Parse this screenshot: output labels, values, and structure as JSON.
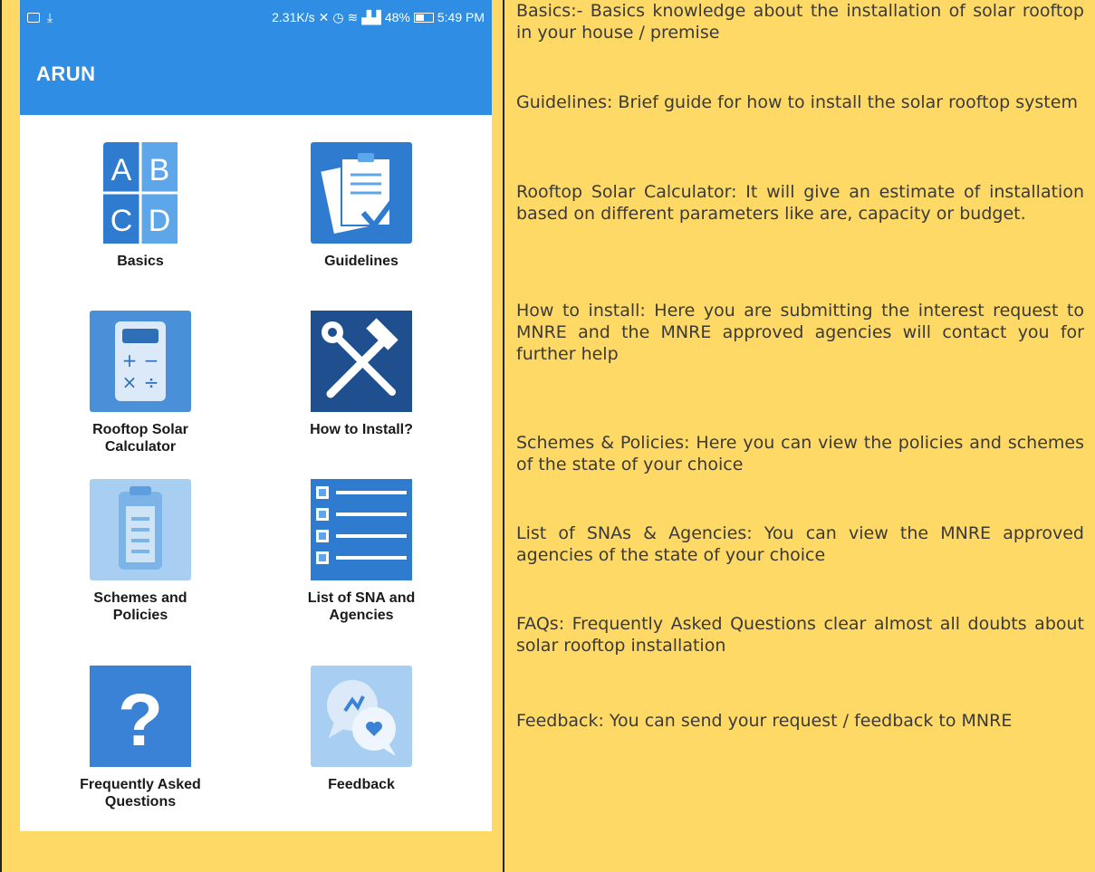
{
  "status_bar": {
    "speed": "2.31K/s",
    "battery": "48%",
    "time": "5:49 PM"
  },
  "app": {
    "title": "ARUN",
    "accent": "#2f8de4"
  },
  "tiles": [
    {
      "label": "Basics",
      "icon": "abcd-icon"
    },
    {
      "label": "Guidelines",
      "icon": "clipboard-check-icon"
    },
    {
      "label": "Rooftop Solar\nCalculator",
      "icon": "calculator-icon"
    },
    {
      "label": "How to Install?",
      "icon": "tools-icon"
    },
    {
      "label": "Schemes and\nPolicies",
      "icon": "document-icon"
    },
    {
      "label": "List of SNA and\nAgencies",
      "icon": "list-icon"
    },
    {
      "label": "Frequently Asked\nQuestions",
      "icon": "question-icon"
    },
    {
      "label": "Feedback",
      "icon": "chat-bubbles-icon"
    }
  ],
  "descriptions": [
    "Basics:- Basics knowledge about the installation of solar rooftop in your house / premise",
    "Guidelines: Brief guide for how to install the solar rooftop system",
    "Rooftop Solar Calculator: It will give an estimate of installation based on different parameters like are, capacity or budget.",
    "How to install:  Here you are submitting the interest request to MNRE and the MNRE approved agencies will contact you for further help",
    "Schemes & Policies: Here you can view the policies and schemes of the state of your choice",
    "List of SNAs & Agencies: You can view the MNRE approved agencies of the state of your choice",
    "FAQs: Frequently Asked Questions clear almost all doubts about solar rooftop installation",
    "Feedback: You can send your request / feedback to MNRE"
  ]
}
